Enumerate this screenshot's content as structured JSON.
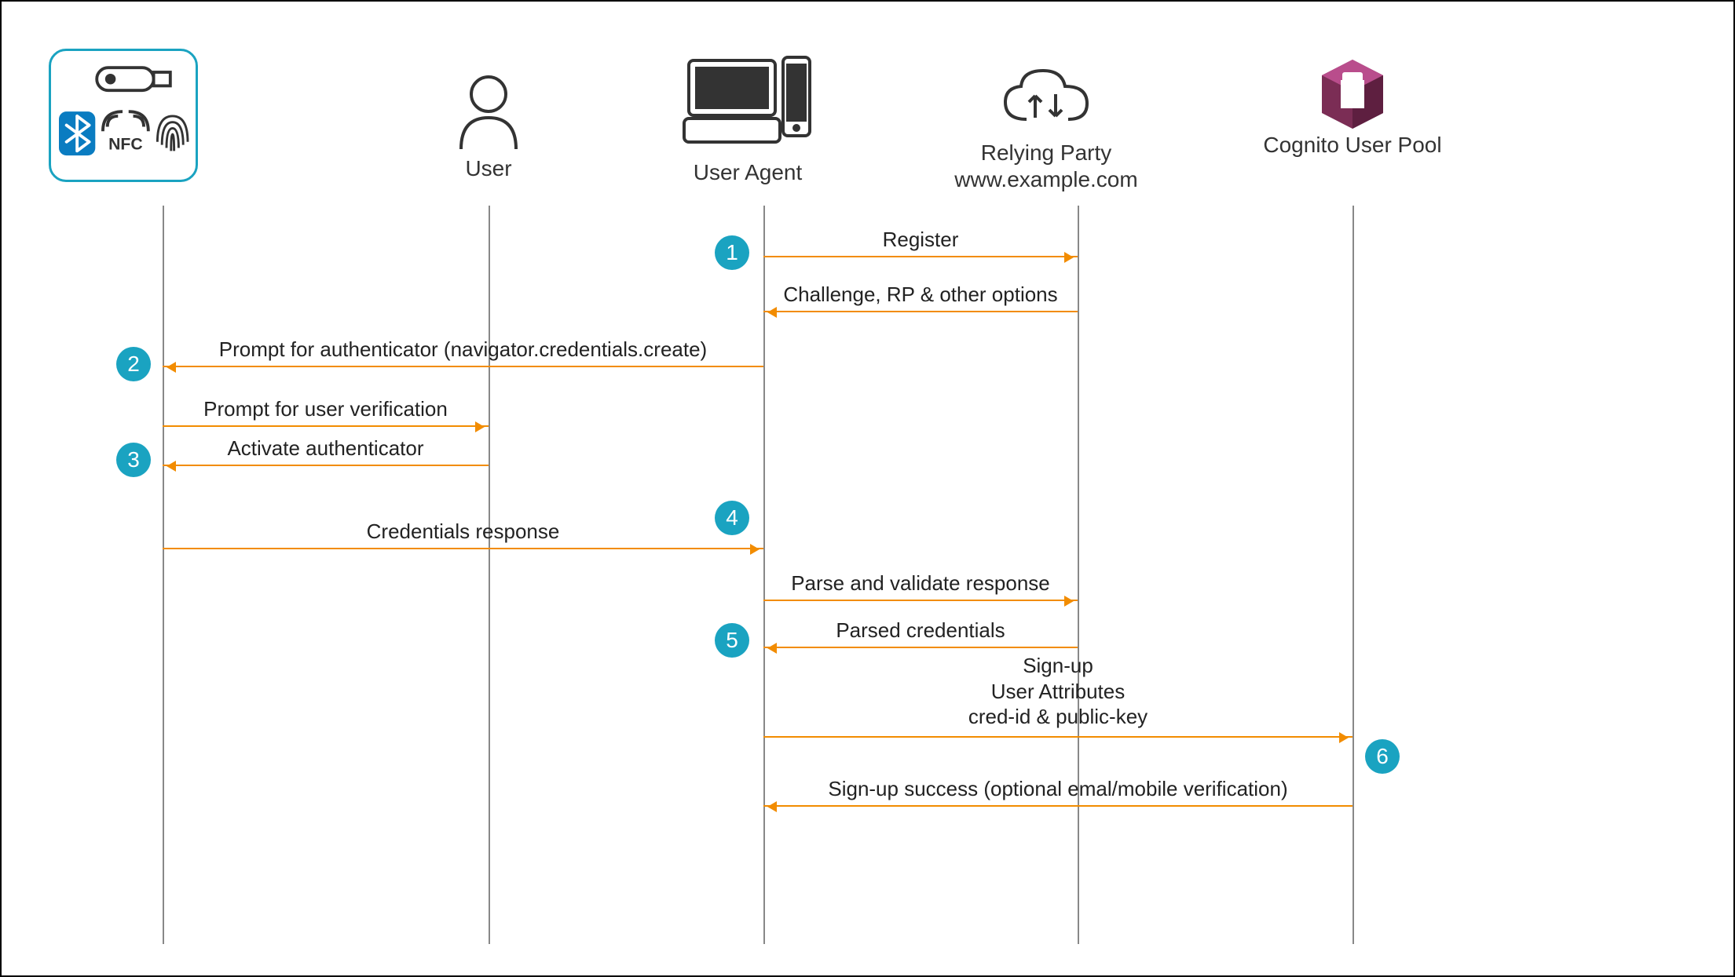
{
  "diagram": {
    "actors": {
      "authenticator": {
        "label": ""
      },
      "user": {
        "label": "User"
      },
      "useragent": {
        "label": "User Agent"
      },
      "relyingparty": {
        "label": "Relying Party\nwww.example.com"
      },
      "cognito": {
        "label": "Cognito\nUser Pool"
      }
    },
    "steps": {
      "s1": {
        "num": "1"
      },
      "s2": {
        "num": "2"
      },
      "s3": {
        "num": "3"
      },
      "s4": {
        "num": "4"
      },
      "s5": {
        "num": "5"
      },
      "s6": {
        "num": "6"
      }
    },
    "messages": {
      "register": "Register",
      "challenge": "Challenge, RP & other options",
      "prompt_auth": "Prompt for authenticator (navigator.credentials.create)",
      "prompt_verify": "Prompt for user verification",
      "activate": "Activate authenticator",
      "cred_response": "Credentials response",
      "parse_validate": "Parse and validate response",
      "parsed_creds": "Parsed credentials",
      "signup_attrs": "Sign-up\nUser Attributes\ncred-id & public-key",
      "signup_success": "Sign-up success (optional emal/mobile verification)"
    }
  }
}
